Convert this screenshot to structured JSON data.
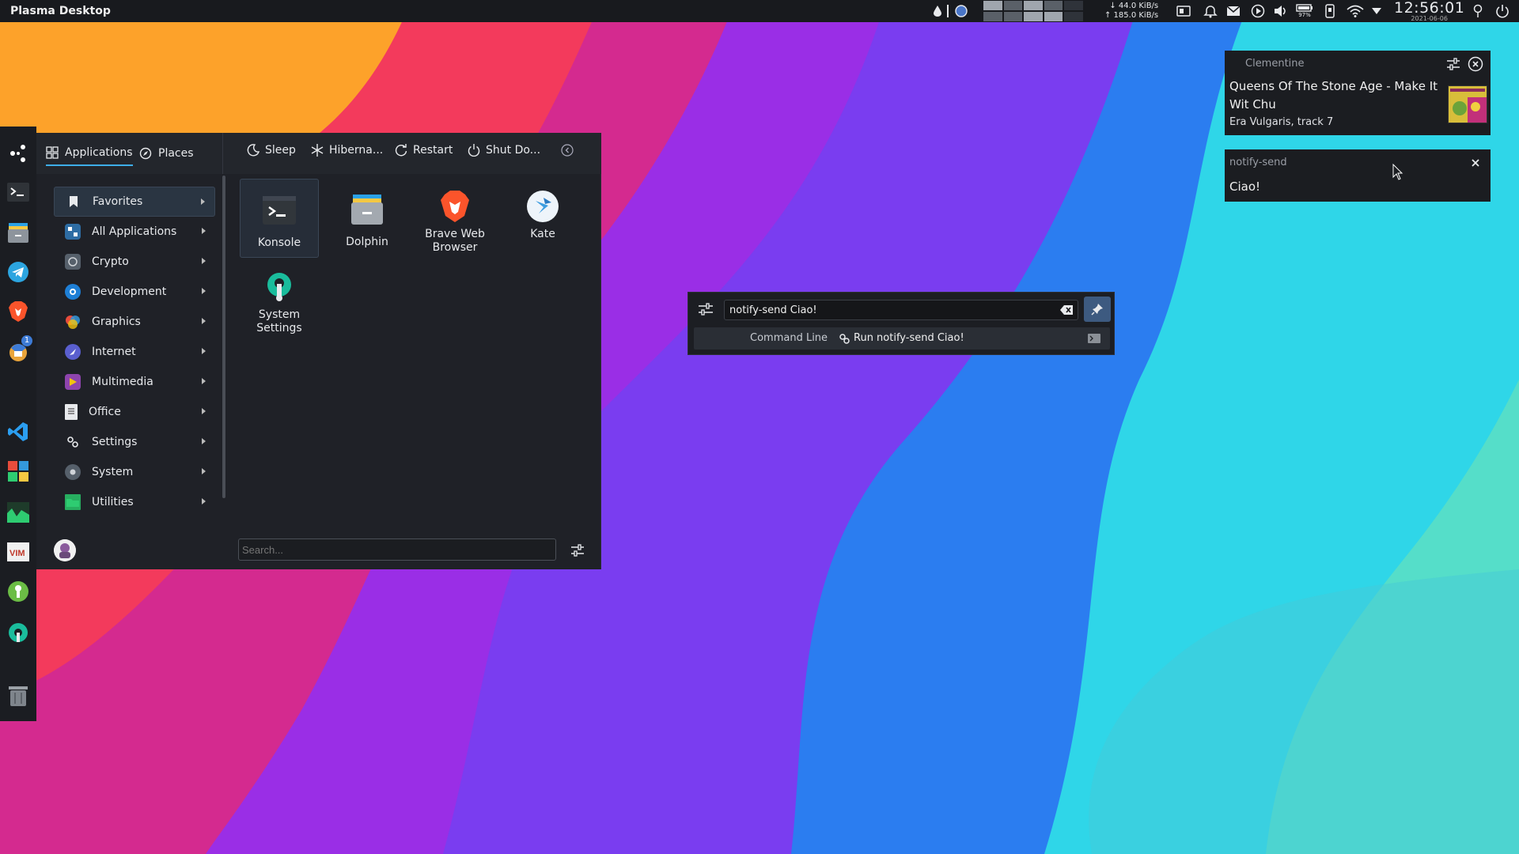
{
  "panel": {
    "title": "Plasma Desktop",
    "net_down": "↓ 44.0 KiB/s",
    "net_up": "↑ 185.0 KiB/s",
    "battery": "97%",
    "clock_time": "12:56:01",
    "clock_date": "2021-06-06"
  },
  "dock": {
    "icons": [
      "menu-launcher-icon",
      "terminal-icon",
      "files-icon",
      "telegram-icon",
      "brave-icon",
      "thunderbird-icon",
      "clementine-icon",
      "vscode-icon",
      "software-center-icon",
      "system-monitor-icon",
      "vim-icon",
      "keepass-icon",
      "system-settings-icon",
      "trash-icon"
    ],
    "badge": "1"
  },
  "kickoff": {
    "tabs": [
      "Applications",
      "Places"
    ],
    "power": [
      "Sleep",
      "Hiberna...",
      "Restart",
      "Shut Do..."
    ],
    "categories": [
      "Favorites",
      "All Applications",
      "Crypto",
      "Development",
      "Graphics",
      "Internet",
      "Multimedia",
      "Office",
      "Settings",
      "System",
      "Utilities"
    ],
    "apps": [
      {
        "name": "Konsole"
      },
      {
        "name": "Dolphin"
      },
      {
        "name": "Brave Web Browser"
      },
      {
        "name": "Kate"
      },
      {
        "name": "System Settings"
      }
    ],
    "search_placeholder": "Search..."
  },
  "krunner": {
    "query": "notify-send Ciao!",
    "result_category": "Command Line",
    "result_label": "Run notify-send Ciao!"
  },
  "notifications": [
    {
      "app": "Clementine",
      "title": "Queens Of The Stone Age - Make It Wit Chu",
      "body": "Era Vulgaris, track 7"
    },
    {
      "app": "notify-send",
      "body": "Ciao!"
    }
  ],
  "colors": {
    "accent": "#3daee9",
    "panel_bg": "#181a1e",
    "menu_bg": "#1f2127"
  }
}
